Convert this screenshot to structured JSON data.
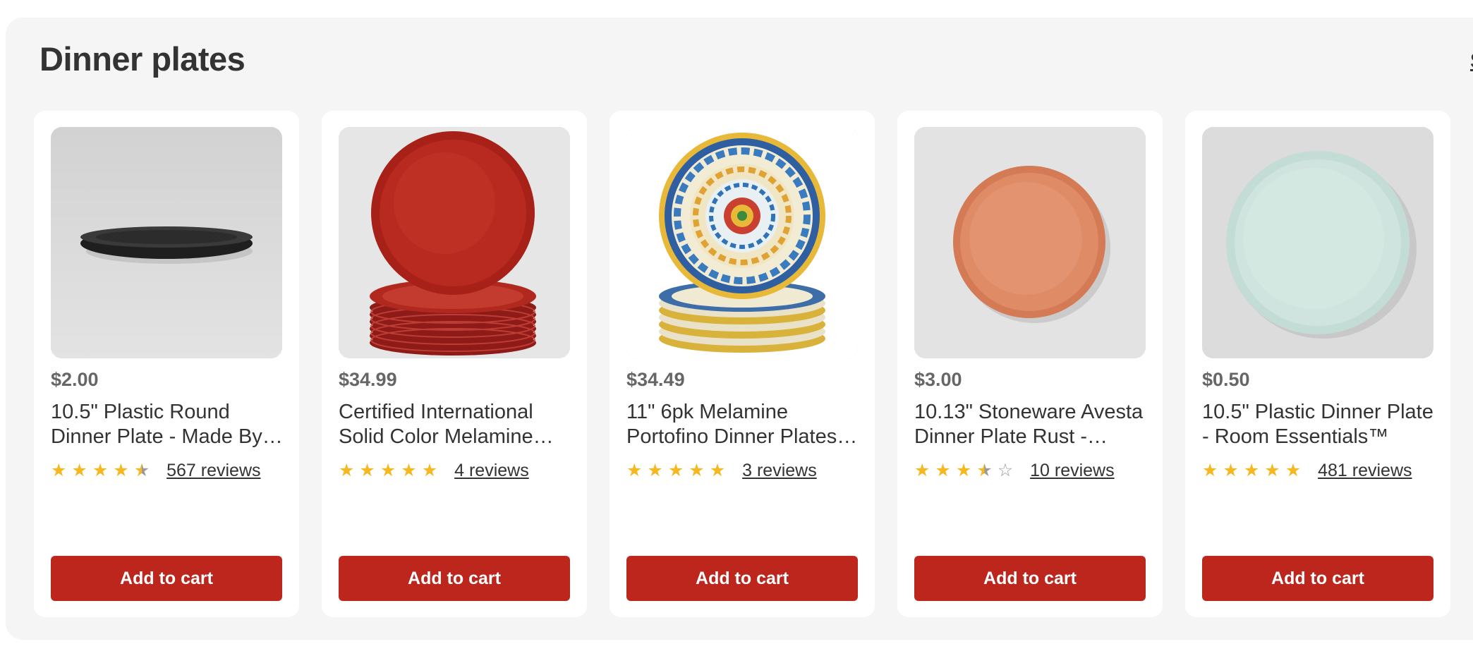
{
  "section": {
    "title": "Dinner plates",
    "see_all_label": "S"
  },
  "colors": {
    "accent": "#bd261c",
    "star": "#f5b820",
    "background": "#f5f5f5"
  },
  "products": [
    {
      "price": "$2.00",
      "name": "10.5\" Plastic Round Dinner Plate - Made By…",
      "rating": 4.5,
      "reviews": "567 reviews",
      "cta": "Add to cart",
      "image": "black-plate-icon"
    },
    {
      "price": "$34.99",
      "name": "Certified International Solid Color Melamine…",
      "rating": 5,
      "reviews": "4 reviews",
      "cta": "Add to cart",
      "image": "red-plate-stack-icon"
    },
    {
      "price": "$34.49",
      "name": "11\" 6pk Melamine Portofino Dinner Plates …",
      "rating": 5,
      "reviews": "3 reviews",
      "cta": "Add to cart",
      "image": "patterned-plate-stack-icon"
    },
    {
      "price": "$3.00",
      "name": "10.13\" Stoneware Avesta Dinner Plate Rust -…",
      "rating": 3.5,
      "reviews": "10 reviews",
      "cta": "Add to cart",
      "image": "rust-plate-icon"
    },
    {
      "price": "$0.50",
      "name": "10.5\" Plastic Dinner Plate - Room Essentials™",
      "rating": 5,
      "reviews": "481 reviews",
      "cta": "Add to cart",
      "image": "mint-plate-icon"
    }
  ]
}
